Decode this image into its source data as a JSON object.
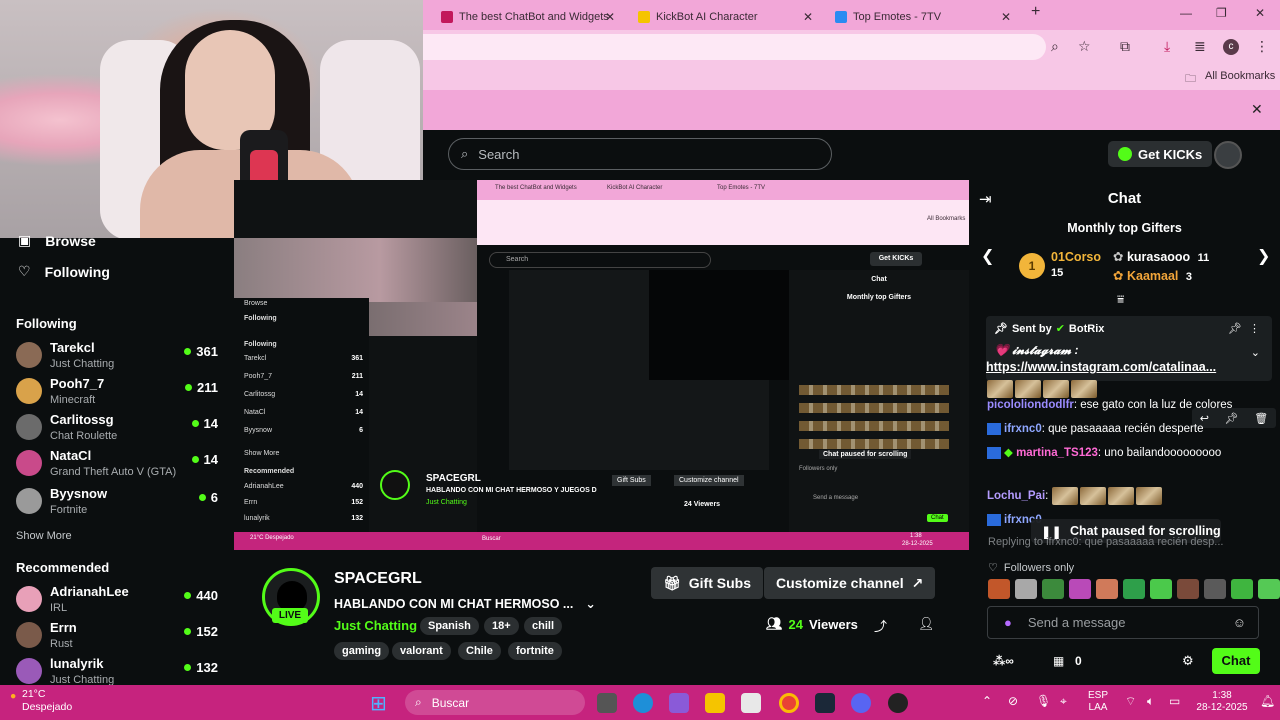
{
  "browser": {
    "tabs": [
      {
        "title": "The best ChatBot and Widgets"
      },
      {
        "title": "KickBot AI Character"
      },
      {
        "title": "Top Emotes - 7TV"
      }
    ],
    "bookmarks_label": "All Bookmarks"
  },
  "page": {
    "search_placeholder": "Search",
    "get_kicks_label": "Get KICKs"
  },
  "sidebar": {
    "browse_label": "Browse",
    "following_nav_label": "Following",
    "following_section": "Following",
    "following": [
      {
        "name": "Tarekcl",
        "category": "Just Chatting",
        "viewers": "361",
        "color": "#8a6a55"
      },
      {
        "name": "Pooh7_7",
        "category": "Minecraft",
        "viewers": "211",
        "color": "#d9a24a"
      },
      {
        "name": "Carlitossg",
        "category": "Chat Roulette",
        "viewers": "14",
        "color": "#6b6b6b"
      },
      {
        "name": "NataCl",
        "category": "Grand Theft Auto V (GTA)",
        "viewers": "14",
        "color": "#c94a8a"
      },
      {
        "name": "Byysnow",
        "category": "Fortnite",
        "viewers": "6",
        "color": "#9a9a9a"
      }
    ],
    "show_more_1": "Show More",
    "recommended_section": "Recommended",
    "recommended": [
      {
        "name": "AdrianahLee",
        "category": "IRL",
        "viewers": "440",
        "color": "#e8a0b8"
      },
      {
        "name": "Errn",
        "category": "Rust",
        "viewers": "152",
        "color": "#7a5a4a"
      },
      {
        "name": "lunalyrik",
        "category": "Just Chatting",
        "viewers": "132",
        "color": "#9a5ab8"
      }
    ]
  },
  "channel": {
    "name": "SPACEGRL",
    "live_label": "LIVE",
    "title": "HABLANDO CON MI CHAT HERMOSO ...",
    "category": "Just Chatting",
    "tags_row1": [
      "Spanish",
      "18+",
      "chill"
    ],
    "tags_row2": [
      "gaming",
      "valorant",
      "Chile",
      "fortnite"
    ],
    "gift_subs_label": "Gift Subs",
    "customize_label": "Customize channel",
    "viewers_count": "24",
    "viewers_label": "Viewers"
  },
  "chat": {
    "title": "Chat",
    "gifters_title": "Monthly top Gifters",
    "gifter1": {
      "name": "01Corso",
      "count": "15",
      "rank": "1"
    },
    "gifter2": {
      "name": "kurasaooo",
      "count": "11"
    },
    "gifter3": {
      "name": "Kaamaal",
      "count": "3"
    },
    "pinned": {
      "sent_by": "Sent by",
      "bot": "BotRix",
      "line1": "💗 𝓲𝓷𝓼𝓽𝓪𝓰𝓻𝓪𝓶 :",
      "link": "https://www.instagram.com/catalinaa..."
    },
    "messages": [
      {
        "user": "picololiondodlfr",
        "text": "ese gato con la luz de colores",
        "color": "#9b8cff"
      },
      {
        "user": "ifrxnc0",
        "text": "que pasaaaaa recién desperte",
        "color": "#8fa7ff"
      },
      {
        "user": "martina_TS123",
        "text": "uno bailandooooooooo",
        "color": "#ff6ad5"
      },
      {
        "user": "Lochu_Pai",
        "text": "",
        "color": "#b59cff"
      },
      {
        "user": "ifrxnc0",
        "text": "",
        "color": "#8fa7ff"
      }
    ],
    "paused_label": "Chat paused for scrolling",
    "replying_label": "Replying to ifrxnc0: que pasaaaaa recién desp...",
    "followers_only_label": "Followers only",
    "input_placeholder": "Send a message",
    "kick_points": "0",
    "chat_button": "Chat"
  },
  "taskbar": {
    "temp": "21°C",
    "weather": "Despejado",
    "search_label": "Buscar",
    "lang1": "ESP",
    "lang2": "LAA",
    "time": "1:38",
    "date": "28-12-2025"
  },
  "nested": {
    "channel_name": "SPACEGRL",
    "title": "HABLANDO CON MI CHAT HERMOSO Y JUEGOS D",
    "category": "Just Chatting",
    "viewers": "24 Viewers",
    "gift": "Gift Subs",
    "customize": "Customize channel",
    "chat_title": "Chat",
    "gifters": "Monthly top Gifters",
    "paused": "Chat paused for scrolling",
    "followers": "Followers only",
    "send": "Send a message",
    "chat_btn": "Chat",
    "search": "Search",
    "get_kicks": "Get KICKs",
    "browse": "Browse",
    "following": "Following",
    "recommended": "Recommended",
    "show_more": "Show More",
    "buscar": "Buscar",
    "tab1": "The best ChatBot and Widgets",
    "tab2": "KickBot AI Character",
    "tab3": "Top Emotes - 7TV",
    "bookmarks": "All Bookmarks",
    "weather": "21°C Despejado",
    "time": "1:38",
    "date": "28-12-2025",
    "list": [
      {
        "n": "Tarekcl",
        "c": "361"
      },
      {
        "n": "Pooh7_7",
        "c": "211"
      },
      {
        "n": "Carlitossg",
        "c": "14"
      },
      {
        "n": "NataCl",
        "c": "14"
      },
      {
        "n": "Byysnow",
        "c": "6"
      }
    ],
    "rec": [
      {
        "n": "AdrianahLee",
        "c": "440"
      },
      {
        "n": "Errn",
        "c": "152"
      },
      {
        "n": "lunalyrik",
        "c": "132"
      }
    ]
  }
}
